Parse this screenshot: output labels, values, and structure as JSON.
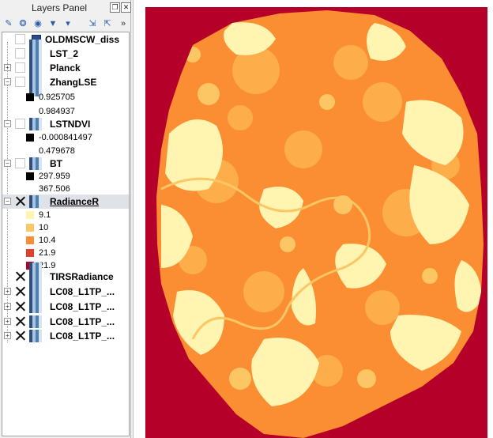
{
  "panel": {
    "title": "Layers Panel",
    "float_button": "❐",
    "close_button": "✕"
  },
  "toolbar": [
    {
      "name": "add-layer-icon",
      "glyph": "✎"
    },
    {
      "name": "style-manager-icon",
      "glyph": "❂"
    },
    {
      "name": "eye-icon",
      "glyph": "◉"
    },
    {
      "name": "filter-icon",
      "glyph": "▼"
    },
    {
      "name": "filter-legend-icon",
      "glyph": "▾"
    },
    {
      "name": "expand-all-icon",
      "glyph": "⇲"
    },
    {
      "name": "collapse-all-icon",
      "glyph": "⇱"
    },
    {
      "name": "more-icon",
      "glyph": "»"
    }
  ],
  "layers": {
    "oldmscw": "OLDMSCW_diss",
    "lst2": "LST_2",
    "planck": "Planck",
    "zhanglse": "ZhangLSE",
    "zhanglse_min": "0.925705",
    "zhanglse_max": "0.984937",
    "lstndvi": "LSTNDVI",
    "lstndvi_min": "-0.000841497",
    "lstndvi_max": "0.479678",
    "bt": "BT",
    "bt_min": "297.959",
    "bt_max": "367.506",
    "radiancer": "RadianceR",
    "radiancer_classes": [
      "9.1",
      "10",
      "10.4",
      "21.9",
      "21.9"
    ],
    "tirs": "TIRSRadiance",
    "lc08_1": "LC08_L1TP_...",
    "lc08_2": "LC08_L1TP_...",
    "lc08_3": "LC08_L1TP_...",
    "lc08_4": "LC08_L1TP_..."
  },
  "colors": {
    "class_1": "#fff4b0",
    "class_2": "#fdc664",
    "class_3": "#fb8d32",
    "class_4": "#e3402c",
    "class_5": "#b5002a",
    "vector_fill": "#2e4a8a"
  }
}
